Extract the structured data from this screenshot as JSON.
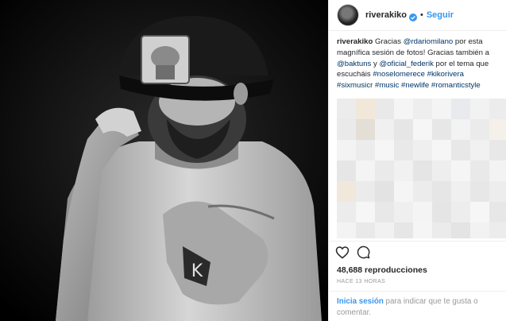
{
  "profile": {
    "username": "riverakiko",
    "follow_label": "Seguir",
    "separator": "•"
  },
  "caption": {
    "username": "riverakiko",
    "t1": " Gracias ",
    "m1": "@rdariomilano",
    "t2": " por esta magnífica sesión de fotos! Gracias también a ",
    "m2": "@baktuns",
    "t3": " y ",
    "m3": "@oficial_federik",
    "t4": " por el tema que escucháis ",
    "h1": "#noselomerece",
    "h2": "#kikorivera",
    "h3": "#sixmusicr",
    "h4": "#music",
    "h5": "#newlife",
    "h6": "#romanticstyle"
  },
  "stats": {
    "views": "48,688 reproducciones",
    "time_ago": "HACE 13 HORAS"
  },
  "login_prompt": {
    "link": "Inicia sesión",
    "text": " para indicar que te gusta o comentar."
  },
  "icons": {
    "like": "heart-icon",
    "comment": "comment-icon",
    "verified": "verified-badge-icon"
  },
  "colors": {
    "link_blue": "#3897f0",
    "tag_blue": "#003569",
    "muted": "#999999",
    "text": "#262626"
  }
}
